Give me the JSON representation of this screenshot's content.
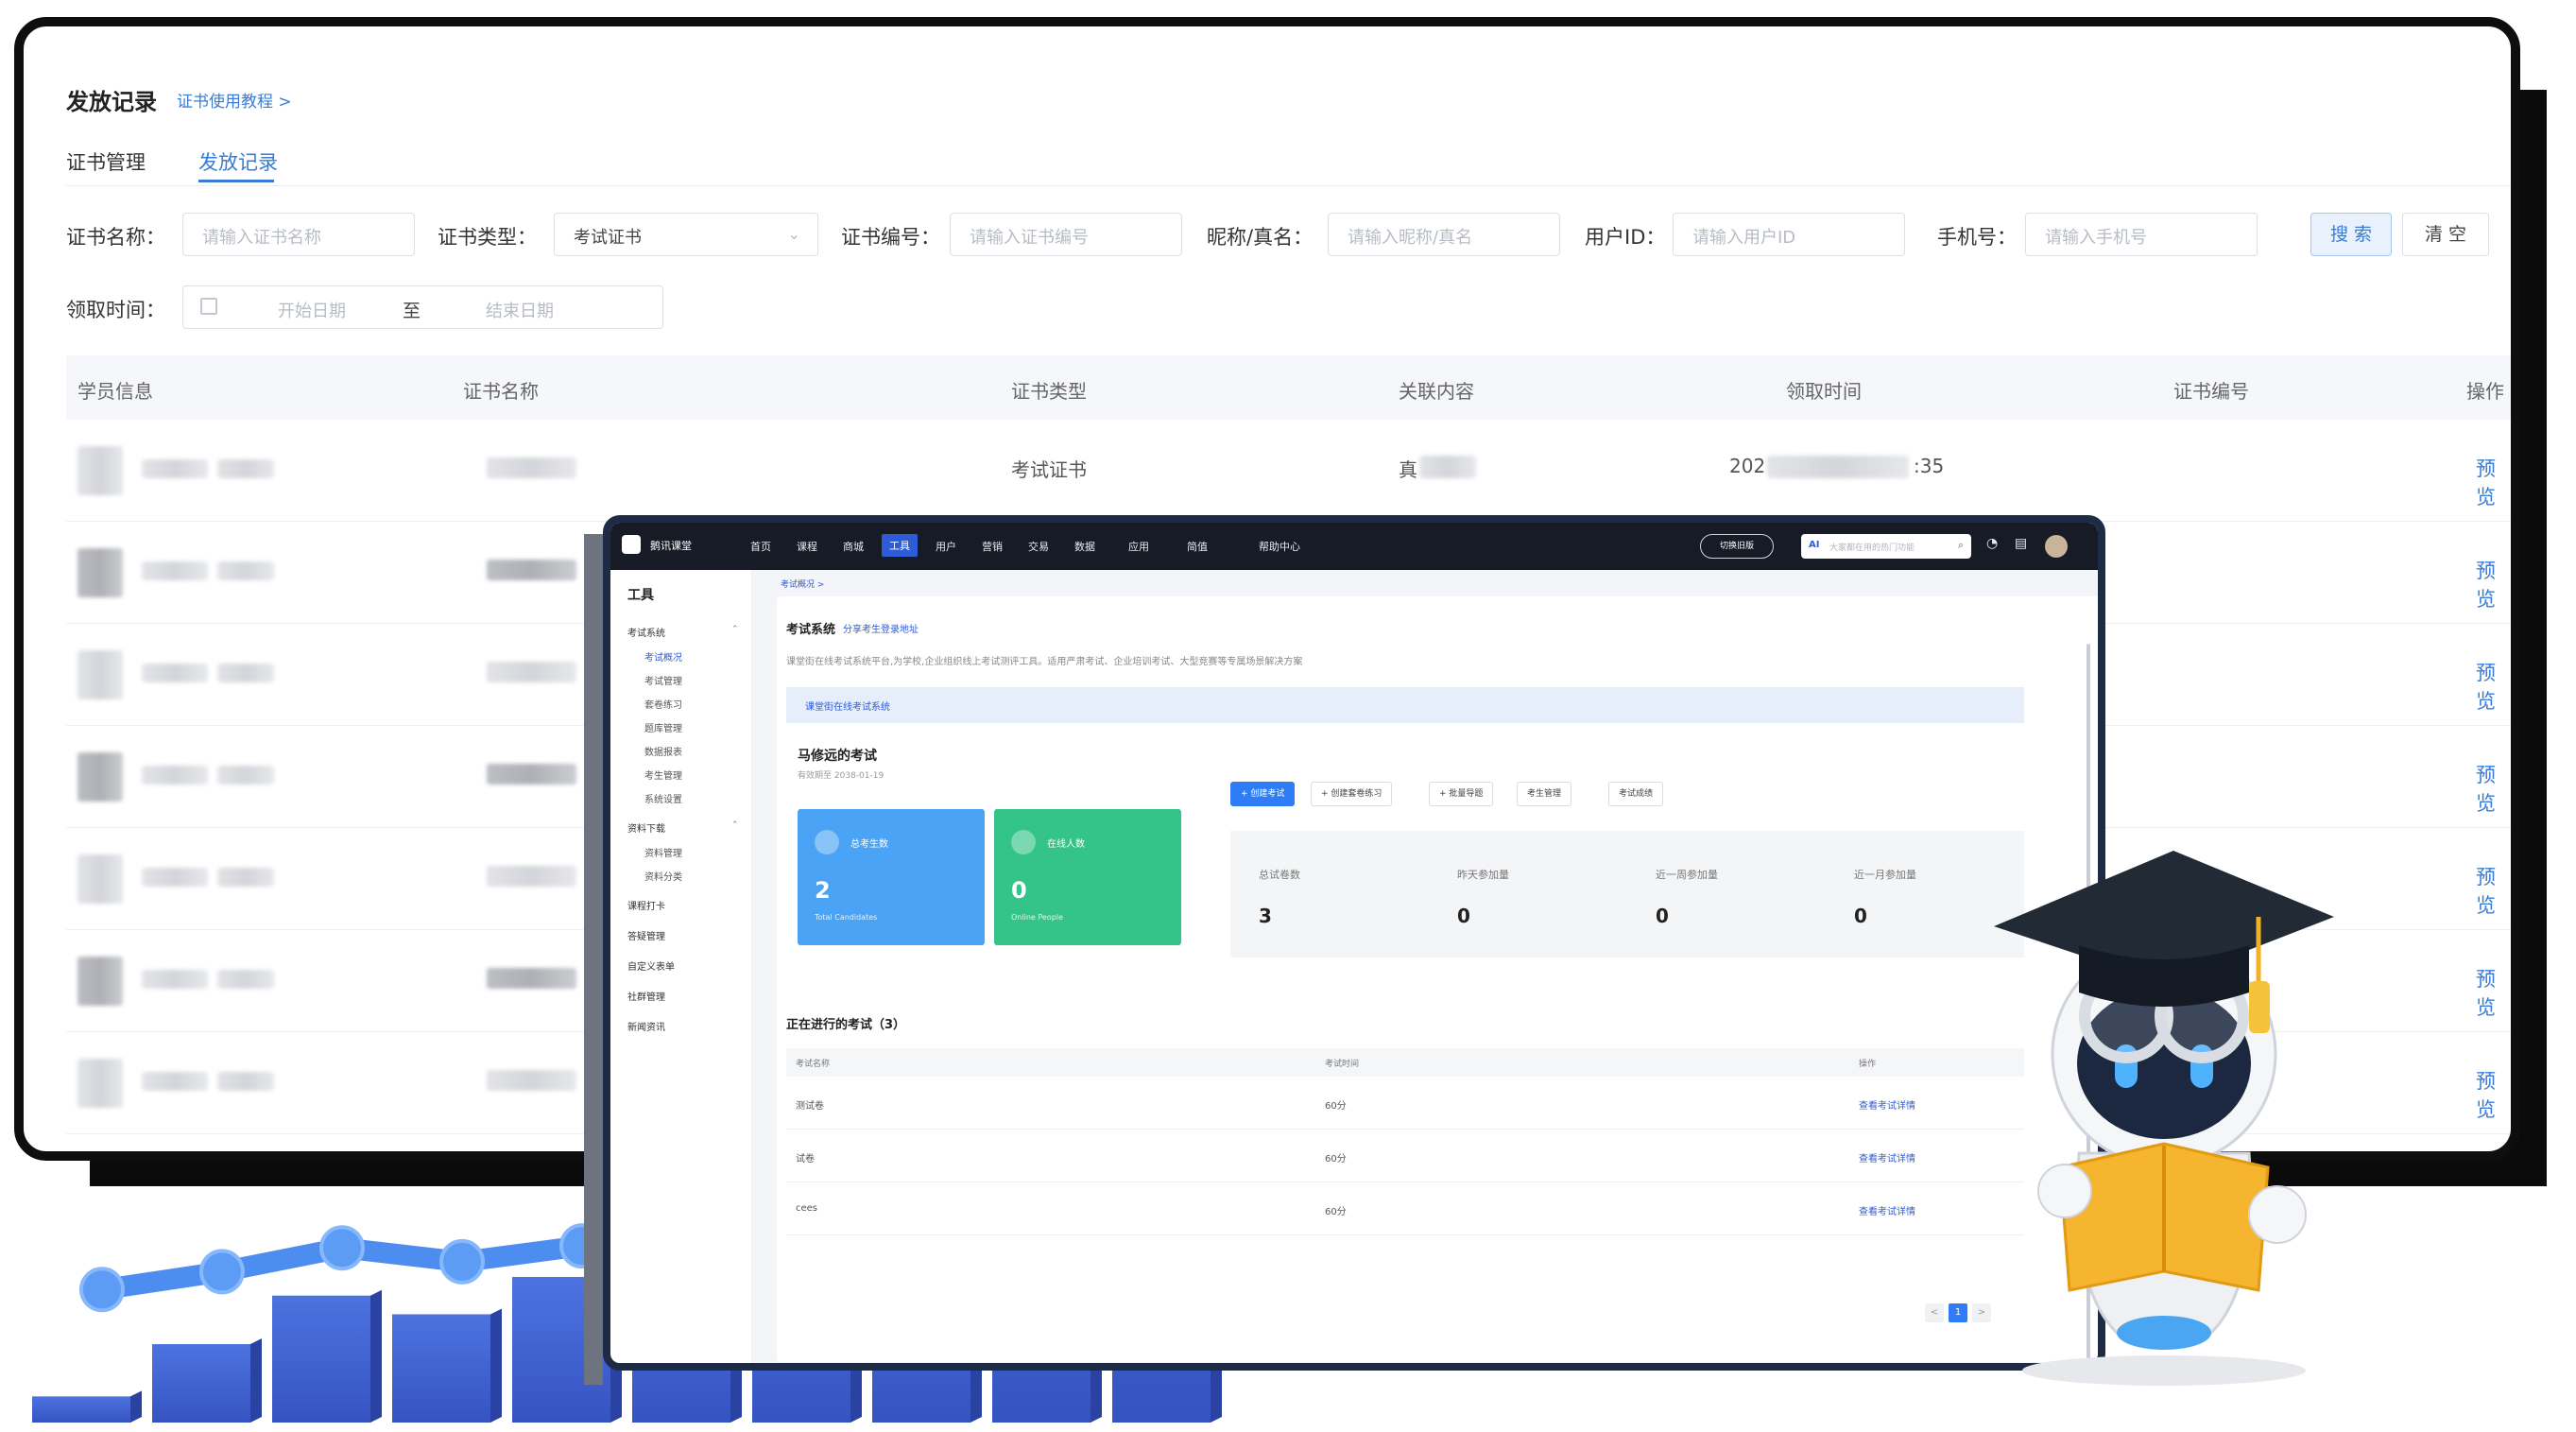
{
  "back_window": {
    "title": "发放记录",
    "tutorial_link": "证书使用教程 >",
    "tabs": [
      {
        "label": "证书管理",
        "active": false
      },
      {
        "label": "发放记录",
        "active": true
      }
    ],
    "filters": {
      "cert_name": {
        "label": "证书名称：",
        "placeholder": "请输入证书名称"
      },
      "cert_type": {
        "label": "证书类型：",
        "value": "考试证书"
      },
      "cert_no": {
        "label": "证书编号：",
        "placeholder": "请输入证书编号"
      },
      "nickname": {
        "label": "昵称/真名：",
        "placeholder": "请输入昵称/真名"
      },
      "user_id": {
        "label": "用户ID：",
        "placeholder": "请输入用户ID"
      },
      "phone": {
        "label": "手机号：",
        "placeholder": "请输入手机号"
      },
      "search_button": "搜 索",
      "clear_button": "清 空",
      "time_label": "领取时间：",
      "start_placeholder": "开始日期",
      "range_separator": "至",
      "end_placeholder": "结束日期"
    },
    "table": {
      "columns": [
        "学员信息",
        "证书名称",
        "证书类型",
        "关联内容",
        "领取时间",
        "证书编号",
        "操作"
      ],
      "first_row": {
        "type": "考试证书",
        "related_prefix": "真",
        "time_prefix": "202",
        "time_suffix": ":35"
      },
      "action_label": "预览",
      "row_count": 8
    }
  },
  "front_window": {
    "brand": "鹅讯课堂",
    "nav": [
      {
        "label": "首页",
        "active": false
      },
      {
        "label": "课程",
        "active": false
      },
      {
        "label": "商城",
        "active": false
      },
      {
        "label": "工具",
        "active": true
      },
      {
        "label": "用户",
        "active": false
      },
      {
        "label": "营销",
        "active": false
      },
      {
        "label": "交易",
        "active": false
      },
      {
        "label": "数据",
        "active": false
      },
      {
        "label": "应用",
        "active": false
      },
      {
        "label": "简值",
        "active": false
      },
      {
        "label": "帮助中心",
        "active": false
      }
    ],
    "switch_label": "切换旧版",
    "search": {
      "ai": "AI",
      "placeholder": "大家都在用的热门功能"
    },
    "sidebar": {
      "title": "工具",
      "groups": [
        {
          "label": "考试系统",
          "items": [
            "考试概况",
            "考试管理",
            "套卷练习",
            "题库管理",
            "数据报表",
            "考生管理",
            "系统设置"
          ]
        },
        {
          "label": "资料下载",
          "items": [
            "资料管理",
            "资料分类"
          ]
        },
        {
          "label": "课程打卡",
          "items": []
        },
        {
          "label": "答疑管理",
          "items": []
        },
        {
          "label": "自定义表单",
          "items": []
        },
        {
          "label": "社群管理",
          "items": []
        },
        {
          "label": "新闻资讯",
          "items": []
        }
      ],
      "active_item": "考试概况"
    },
    "breadcrumb": "考试概况 >",
    "header": {
      "title": "考试系统",
      "share_link": "分享考生登录地址",
      "description": "课堂街在线考试系统平台,为学校,企业组织线上考试测评工具。适用严肃考试、企业培训考试、大型竞赛等专属场景解决方案"
    },
    "banner": "课堂街在线考试系统",
    "exam": {
      "title": "马修远的考试",
      "valid_until": "有效期至 2038-01-19",
      "stat_total": {
        "label": "总考生数",
        "value": "2",
        "sub": "Total Candidates"
      },
      "stat_online": {
        "label": "在线人数",
        "value": "0",
        "sub": "Online People"
      }
    },
    "actions": [
      "+ 创建考试",
      "+ 创建套卷练习",
      "+ 批量导题",
      "考生管理",
      "考试成绩"
    ],
    "kpis": [
      {
        "label": "总试卷数",
        "value": "3"
      },
      {
        "label": "昨天参加量",
        "value": "0"
      },
      {
        "label": "近一周参加量",
        "value": "0"
      },
      {
        "label": "近一月参加量",
        "value": "0"
      }
    ],
    "ongoing": {
      "title": "正在进行的考试（3）",
      "columns": [
        "考试名称",
        "考试时间",
        "操作"
      ],
      "rows": [
        {
          "name": "测试卷",
          "time": "60分",
          "action": "查看考试详情"
        },
        {
          "name": "试卷",
          "time": "60分",
          "action": "查看考试详情"
        },
        {
          "name": "cees",
          "time": "60分",
          "action": "查看考试详情"
        }
      ]
    },
    "pagination": {
      "prev": "<",
      "current": "1",
      "next": ">"
    }
  },
  "growth_chart": {
    "bars": [
      0.7,
      2.1,
      3.4,
      2.9,
      3.9,
      4.7,
      5.4,
      5.4,
      8.5,
      11.3
    ],
    "line": [
      1.7,
      2.6,
      3.8,
      3.1,
      3.9,
      4.7,
      6.8,
      8.9,
      14.2,
      20.0
    ],
    "bar_color": "#3f63cf",
    "line_color": "#4d8df0"
  },
  "colors": {
    "accent": "#3a7bd5",
    "stat_blue": "#4aa3f5",
    "stat_green": "#34c389",
    "nav_dark": "#171b26"
  }
}
